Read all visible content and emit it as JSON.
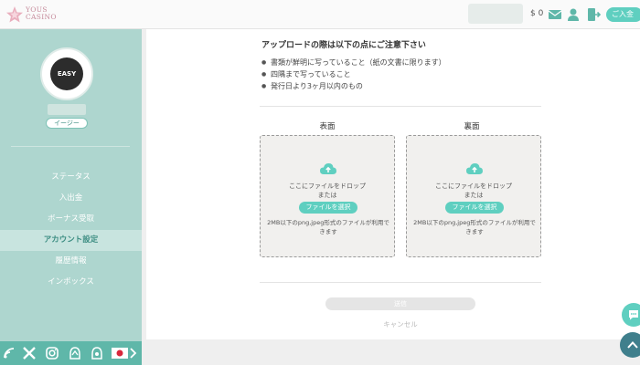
{
  "header": {
    "logo_line1": "YOUS",
    "logo_line2": "CASINO",
    "balance": "$ 0",
    "deposit_label": "ご入金",
    "icons": [
      "mail-icon",
      "user-icon",
      "logout-icon"
    ]
  },
  "sidebar": {
    "avatar_text": "EASY",
    "tier": "イージー",
    "items": [
      {
        "label": "ステータス",
        "active": false
      },
      {
        "label": "入出金",
        "active": false
      },
      {
        "label": "ボーナス受取",
        "active": false
      },
      {
        "label": "アカウント設定",
        "active": true
      },
      {
        "label": "履歴情報",
        "active": false
      },
      {
        "label": "インボックス",
        "active": false
      }
    ],
    "footer_icons": [
      "signal-icon",
      "x-icon",
      "instagram-icon",
      "telegram-icon",
      "japan-flag-icon",
      "chevron-right-icon"
    ]
  },
  "upload": {
    "notice_title": "アップロードの際は以下の点にご注意下さい",
    "notices": [
      "書類が鮮明に写っていること（紙の文書に限ります）",
      "四隅まで写っていること",
      "発行日より3ヶ月以内のもの"
    ],
    "front_label": "表面",
    "back_label": "裏面",
    "drop_text": "ここにファイルをドロップ",
    "or_text": "または",
    "select_button": "ファイルを選択",
    "file_note": "2MB以下のpng,jpeg形式のファイルが利用できます",
    "submit_label": "送信",
    "cancel_label": "キャンセル"
  },
  "colors": {
    "accent": "#5fcfc0",
    "sidebar": "#aed6cf",
    "sidebar_footer": "#5fb7a9"
  }
}
